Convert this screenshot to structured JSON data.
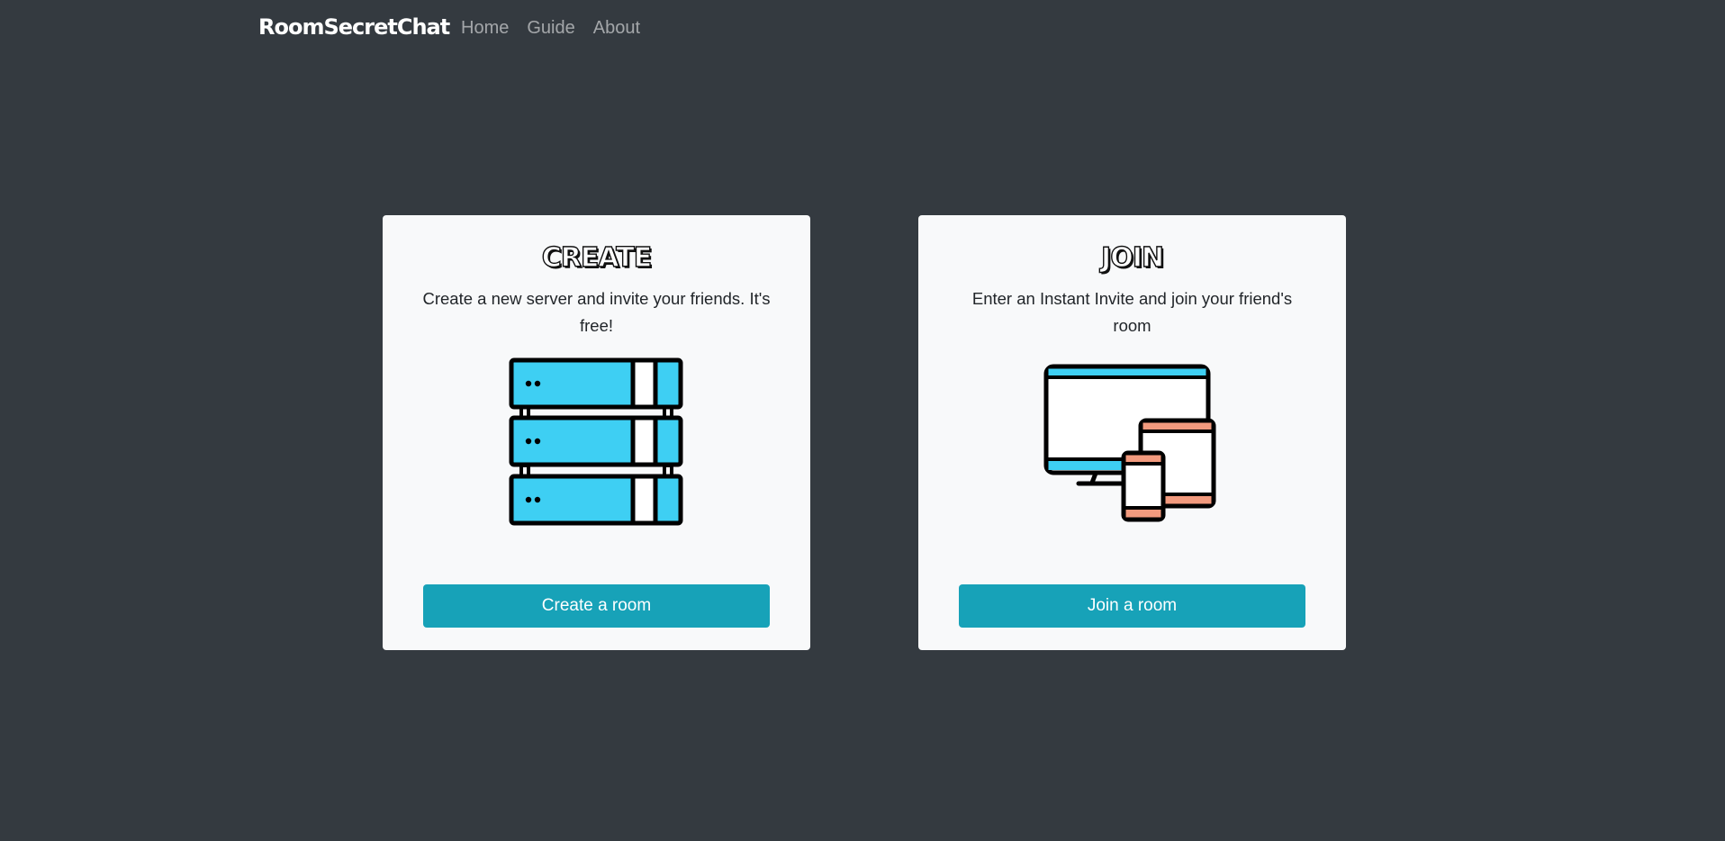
{
  "navbar": {
    "brand": "RoomSecretChat",
    "links": [
      "Home",
      "Guide",
      "About"
    ]
  },
  "cards": {
    "create": {
      "title": "CREATE",
      "text": "Create a new server and invite your friends. It's free!",
      "button": "Create a room",
      "illustration": "server-rack-icon"
    },
    "join": {
      "title": "JOIN",
      "text": "Enter an Instant Invite and join your friend's room",
      "button": "Join a room",
      "illustration": "devices-icon"
    }
  },
  "colors": {
    "background": "#343a40",
    "card": "#f8f9fa",
    "button": "#17a2b8",
    "server_blue": "#3ecff3",
    "device_orange": "#f29a7e"
  }
}
